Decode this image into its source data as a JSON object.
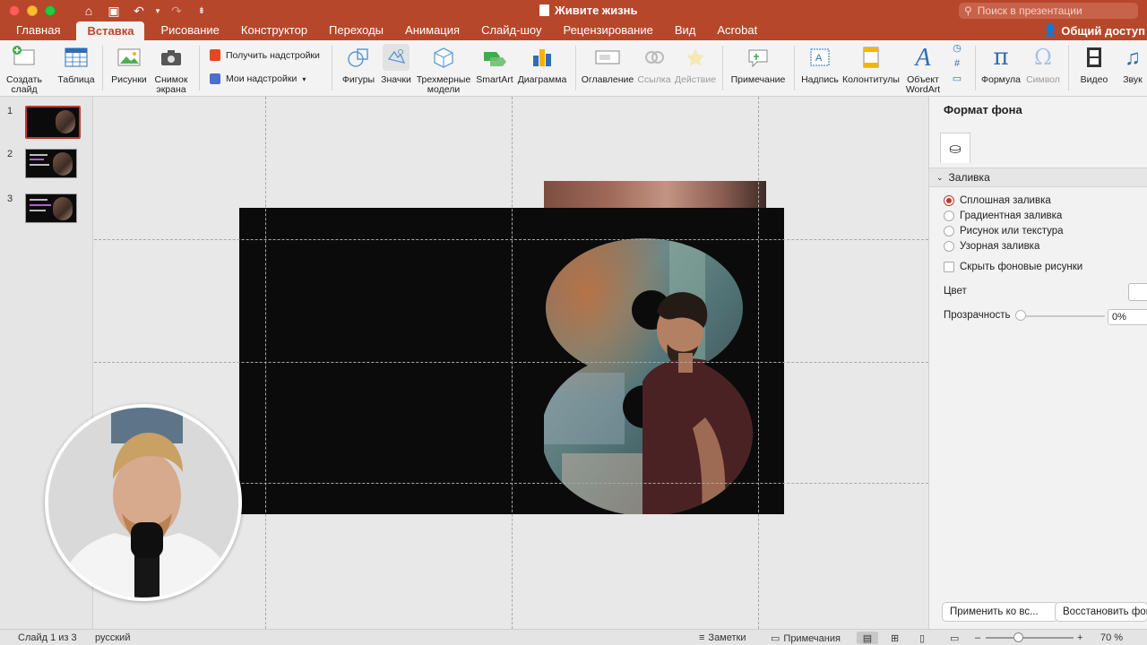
{
  "window": {
    "title": "Живите жизнь",
    "search_placeholder": "Поиск в презентации",
    "share_label": "Общий доступ"
  },
  "tabs": [
    "Главная",
    "Вставка",
    "Рисование",
    "Конструктор",
    "Переходы",
    "Анимация",
    "Слайд-шоу",
    "Рецензирование",
    "Вид",
    "Acrobat"
  ],
  "active_tab": "Вставка",
  "ribbon": {
    "new_slide": "Создать слайд",
    "table": "Таблица",
    "pictures": "Рисунки",
    "screenshot": "Снимок экрана",
    "get_addins": "Получить надстройки",
    "my_addins": "Мои надстройки",
    "shapes": "Фигуры",
    "icons": "Значки",
    "models3d": "Трехмерные модели",
    "smartart": "SmartArt",
    "chart": "Диаграмма",
    "toc": "Оглавление",
    "link": "Ссылка",
    "action": "Действие",
    "comment": "Примечание",
    "textbox": "Надпись",
    "header_footer": "Колонтитулы",
    "wordart": "Объект WordArt",
    "equation": "Формула",
    "symbol": "Символ",
    "video": "Видео",
    "audio": "Звук"
  },
  "slides": [
    {
      "number": "1",
      "selected": true
    },
    {
      "number": "2",
      "selected": false
    },
    {
      "number": "3",
      "selected": false
    }
  ],
  "format_panel": {
    "title": "Формат фона",
    "section": "Заливка",
    "options": [
      {
        "label": "Сплошная заливка",
        "checked": true
      },
      {
        "label": "Градиентная заливка",
        "checked": false
      },
      {
        "label": "Рисунок или текстура",
        "checked": false
      },
      {
        "label": "Узорная заливка",
        "checked": false
      }
    ],
    "hide_bg": "Скрыть фоновые рисунки",
    "color_label": "Цвет",
    "transparency_label": "Прозрачность",
    "transparency_value": "0%",
    "apply_all": "Применить ко вс...",
    "reset": "Восстановить фон"
  },
  "statusbar": {
    "slide_info": "Слайд 1 из 3",
    "language": "русский",
    "notes": "Заметки",
    "comments": "Примечания",
    "zoom": "70 %"
  },
  "colors": {
    "brand": "#b7472a",
    "slide_bg": "#0b0b0b",
    "accent_red": "#c0392b"
  }
}
